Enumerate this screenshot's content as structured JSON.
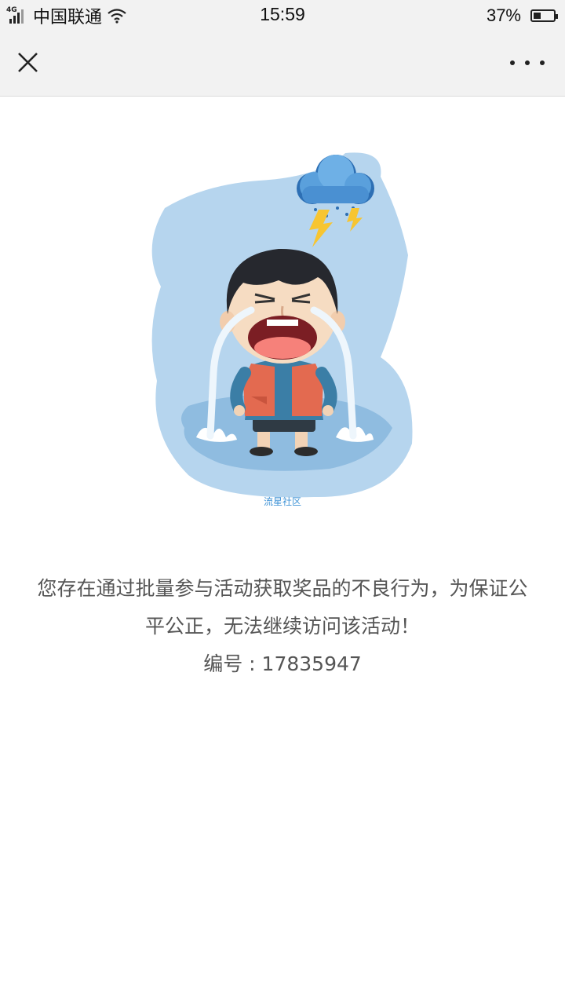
{
  "status_bar": {
    "network": "4G",
    "carrier": "中国联通",
    "time": "15:59",
    "battery_percent": "37%",
    "battery_level": 0.37
  },
  "nav": {
    "close_icon": "close-icon",
    "more_icon": "more-dots-icon"
  },
  "illustration": {
    "watermark": "流星社区"
  },
  "message": {
    "text": "您存在通过批量参与活动获取奖品的不良行为，为保证公平公正，无法继续访问该活动！",
    "code_label": "编号",
    "code_sep": " : ",
    "code_value": "17835947"
  }
}
